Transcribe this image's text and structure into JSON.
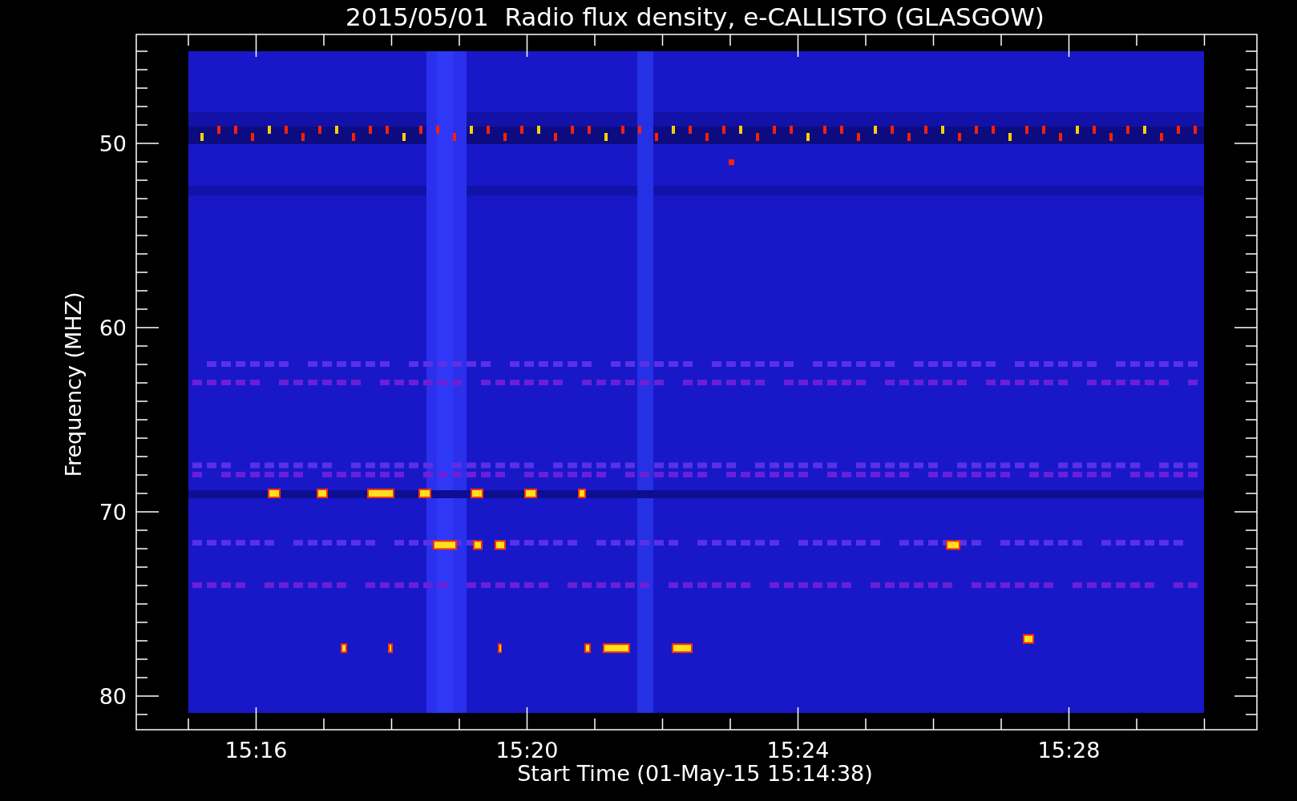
{
  "plot": {
    "title": "2015/05/01  Radio flux density, e-CALLISTO (GLASGOW)",
    "xlabel": "Start Time (01-May-15 15:14:38)",
    "ylabel": "Frequency (MHZ)",
    "xtick_labels": [
      "15:16",
      "15:20",
      "15:24",
      "15:28"
    ],
    "ytick_labels": [
      "50",
      "60",
      "70",
      "80"
    ]
  }
}
